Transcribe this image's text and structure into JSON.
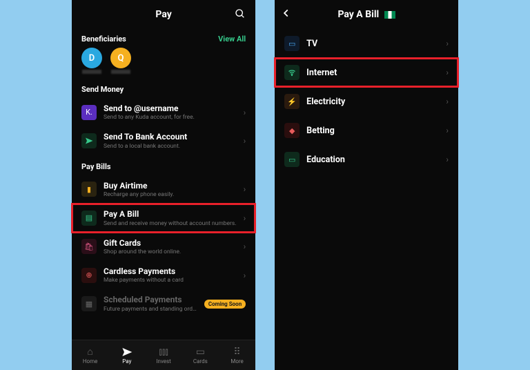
{
  "screen1": {
    "title": "Pay",
    "beneficiaries_label": "Beneficiaries",
    "view_all": "View All",
    "avatars": [
      {
        "initial": "D",
        "color": "blue"
      },
      {
        "initial": "Q",
        "color": "orange"
      }
    ],
    "send_money_label": "Send Money",
    "send_rows": [
      {
        "icon": "k-logo",
        "title": "Send to @username",
        "sub": "Send to any Kuda account, for free."
      },
      {
        "icon": "send",
        "title": "Send To Bank Account",
        "sub": "Send to a local bank account."
      }
    ],
    "pay_bills_label": "Pay Bills",
    "pay_rows": [
      {
        "icon": "phone",
        "title": "Buy Airtime",
        "sub": "Recharge any phone easily.",
        "highlight": false
      },
      {
        "icon": "bill",
        "title": "Pay A Bill",
        "sub": "Send and receive money without account numbers.",
        "highlight": true
      },
      {
        "icon": "gift",
        "title": "Gift Cards",
        "sub": "Shop around the world online."
      },
      {
        "icon": "globe",
        "title": "Cardless Payments",
        "sub": "Make payments without a card"
      },
      {
        "icon": "calendar",
        "title": "Scheduled Payments",
        "sub": "Future payments and standing orders.",
        "badge": "Coming Soon",
        "dim": true
      }
    ],
    "tabs": [
      {
        "label": "Home",
        "icon": "home"
      },
      {
        "label": "Pay",
        "icon": "send",
        "active": true
      },
      {
        "label": "Invest",
        "icon": "chart"
      },
      {
        "label": "Cards",
        "icon": "cards"
      },
      {
        "label": "More",
        "icon": "grid"
      }
    ]
  },
  "screen2": {
    "title": "Pay A Bill",
    "categories": [
      {
        "icon": "tv",
        "label": "TV"
      },
      {
        "icon": "wifi",
        "label": "Internet",
        "highlight": true
      },
      {
        "icon": "bolt",
        "label": "Electricity"
      },
      {
        "icon": "chip",
        "label": "Betting"
      },
      {
        "icon": "book",
        "label": "Education"
      }
    ]
  }
}
